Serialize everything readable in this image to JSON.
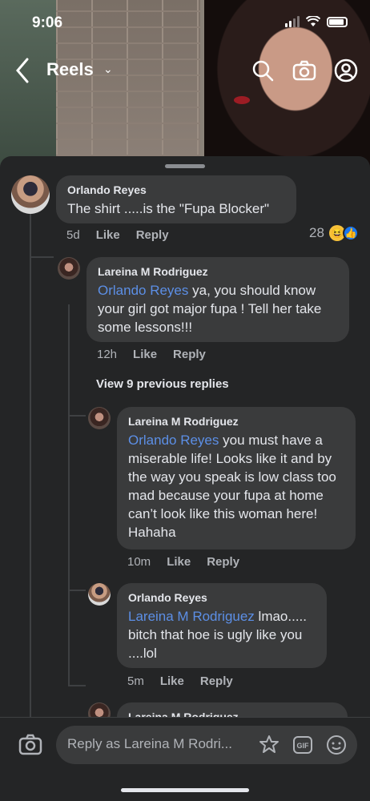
{
  "status_bar": {
    "time": "9:06"
  },
  "nav": {
    "title": "Reels",
    "icons": [
      "back-icon",
      "chevron-down-icon",
      "search-icon",
      "camera-icon",
      "profile-icon"
    ]
  },
  "comments": [
    {
      "author": "Orlando Reyes",
      "text": "The shirt .....is the \"Fupa Blocker\"",
      "age": "5d",
      "like": "Like",
      "reply": "Reply",
      "reaction_count": "28"
    },
    {
      "author": "Lareina M Rodriguez",
      "mention": "Orlando Reyes",
      "text": " ya, you should know your girl got major fupa ! Tell her take some lessons!!!",
      "age": "12h",
      "like": "Like",
      "reply": "Reply"
    },
    {
      "view_previous": "View 9 previous replies"
    },
    {
      "author": "Lareina M Rodriguez",
      "mention": "Orlando Reyes",
      "text": " you must have a miserable life! Looks like it and by the way you speak is low class too mad because your fupa at home can’t look like this woman here! Hahaha",
      "age": "10m",
      "like": "Like",
      "reply": "Reply"
    },
    {
      "author": "Orlando Reyes",
      "mention": "Lareina M Rodriguez",
      "text": " lmao..... bitch that hoe is ugly like you ....lol",
      "age": "5m",
      "like": "Like",
      "reply": "Reply"
    },
    {
      "author": "Lareina M Rodriguez"
    }
  ],
  "reply_bar": {
    "placeholder": "Reply as Lareina M Rodri...",
    "icons": [
      "camera-icon",
      "sticker-icon",
      "gif-icon",
      "emoji-icon"
    ],
    "gif_label": "GIF"
  },
  "colors": {
    "panel": "#242526",
    "bubble": "#3a3b3c",
    "mention": "#5c8fe6",
    "meta": "#b0b3b8"
  }
}
